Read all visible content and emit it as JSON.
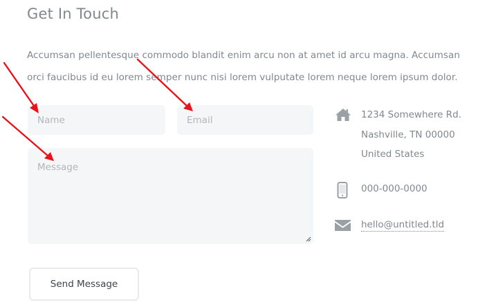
{
  "contact": {
    "title": "Get In Touch",
    "intro": "Accumsan pellentesque commodo blandit enim arcu non at amet id arcu magna. Accumsan orci faucibus id eu lorem semper nunc nisi lorem vulputate lorem neque lorem ipsum dolor."
  },
  "form": {
    "name_placeholder": "Name",
    "email_placeholder": "Email",
    "message_placeholder": "Message",
    "submit_label": "Send Message"
  },
  "info": {
    "address_line1": "1234 Somewhere Rd.",
    "address_line2": "Nashville, TN 00000",
    "address_line3": "United States",
    "phone": "000-000-0000",
    "email": "hello@untitled.tld"
  },
  "icons": {
    "address": "home-icon",
    "phone": "mobile-phone-icon",
    "email": "envelope-icon"
  },
  "colors": {
    "text": "#7f888f",
    "field_bg": "#f5f6f7",
    "annotation_arrow": "#e8141b"
  }
}
